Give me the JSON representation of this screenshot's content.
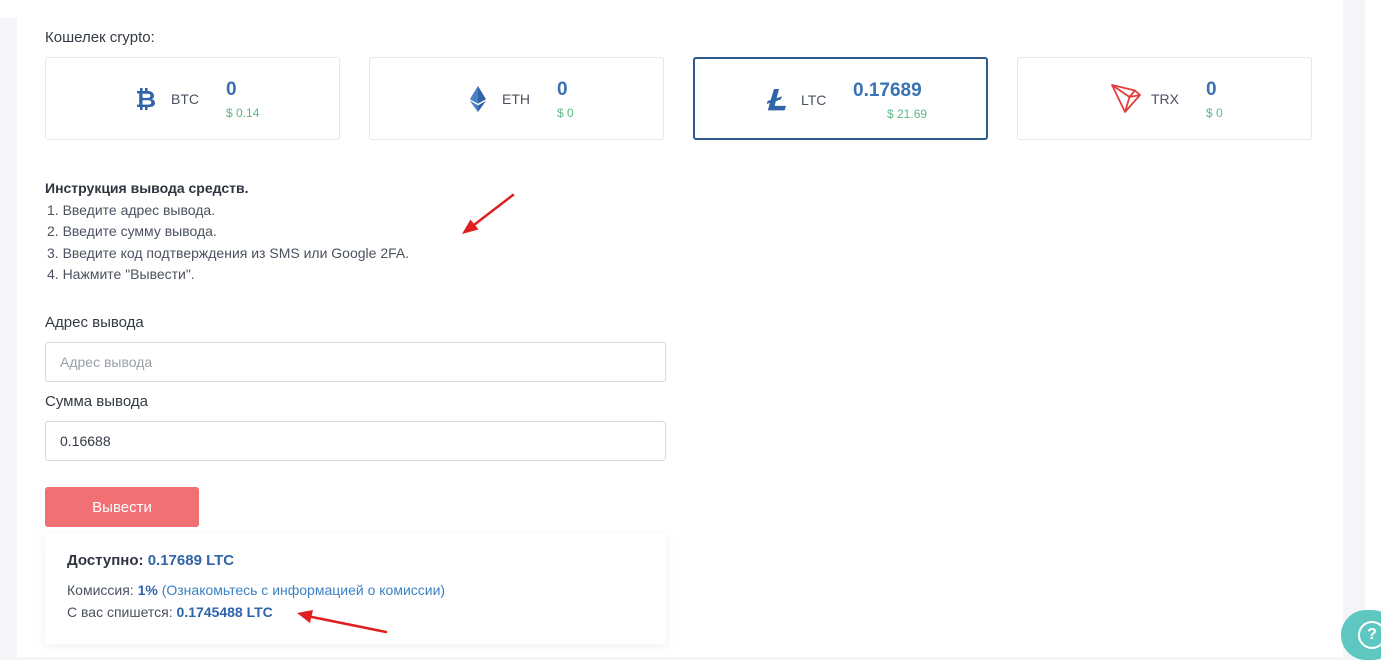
{
  "wallet": {
    "label": "Кошелек crypto:",
    "coins": [
      {
        "code": "BTC",
        "amount": "0",
        "usd": "$ 0.14",
        "icon": "bitcoin-icon",
        "color": "#2f64a8",
        "active": false
      },
      {
        "code": "ETH",
        "amount": "0",
        "usd": "$ 0",
        "icon": "ethereum-icon",
        "color": "#2f64a8",
        "active": false
      },
      {
        "code": "LTC",
        "amount": "0.17689",
        "usd": "$ 21.69",
        "icon": "litecoin-icon",
        "color": "#2f64a8",
        "active": true
      },
      {
        "code": "TRX",
        "amount": "0",
        "usd": "$ 0",
        "icon": "tron-icon",
        "color": "#e0403b",
        "active": false
      }
    ]
  },
  "instructions": {
    "title": "Инструкция вывода средств.",
    "steps": [
      "1. Введите адрес вывода.",
      "2. Введите сумму вывода.",
      "3. Введите код подтверждения из SMS или Google 2FA.",
      "4. Нажмите \"Вывести\"."
    ]
  },
  "form": {
    "address_label": "Адрес вывода",
    "address_placeholder": "Адрес вывода",
    "address_value": "",
    "amount_label": "Сумма вывода",
    "amount_value": "0.16688",
    "submit_label": "Вывести"
  },
  "summary": {
    "available_label": "Доступно:",
    "available_value": "0.17689 LTC",
    "fee_label": "Комиссия:",
    "fee_value": "1%",
    "fee_link": "(Ознакомьтесь с информацией о комиссии)",
    "charge_label": "С вас спишется:",
    "charge_value": "0.1745488 LTC"
  },
  "help": {
    "icon": "question-icon",
    "symbol": "?"
  },
  "colors": {
    "accent_blue": "#2f64a8",
    "usd_green": "#5cb683",
    "button_red": "#f07074",
    "annotation_red": "#e02020",
    "help_teal": "#5ec8c0"
  }
}
